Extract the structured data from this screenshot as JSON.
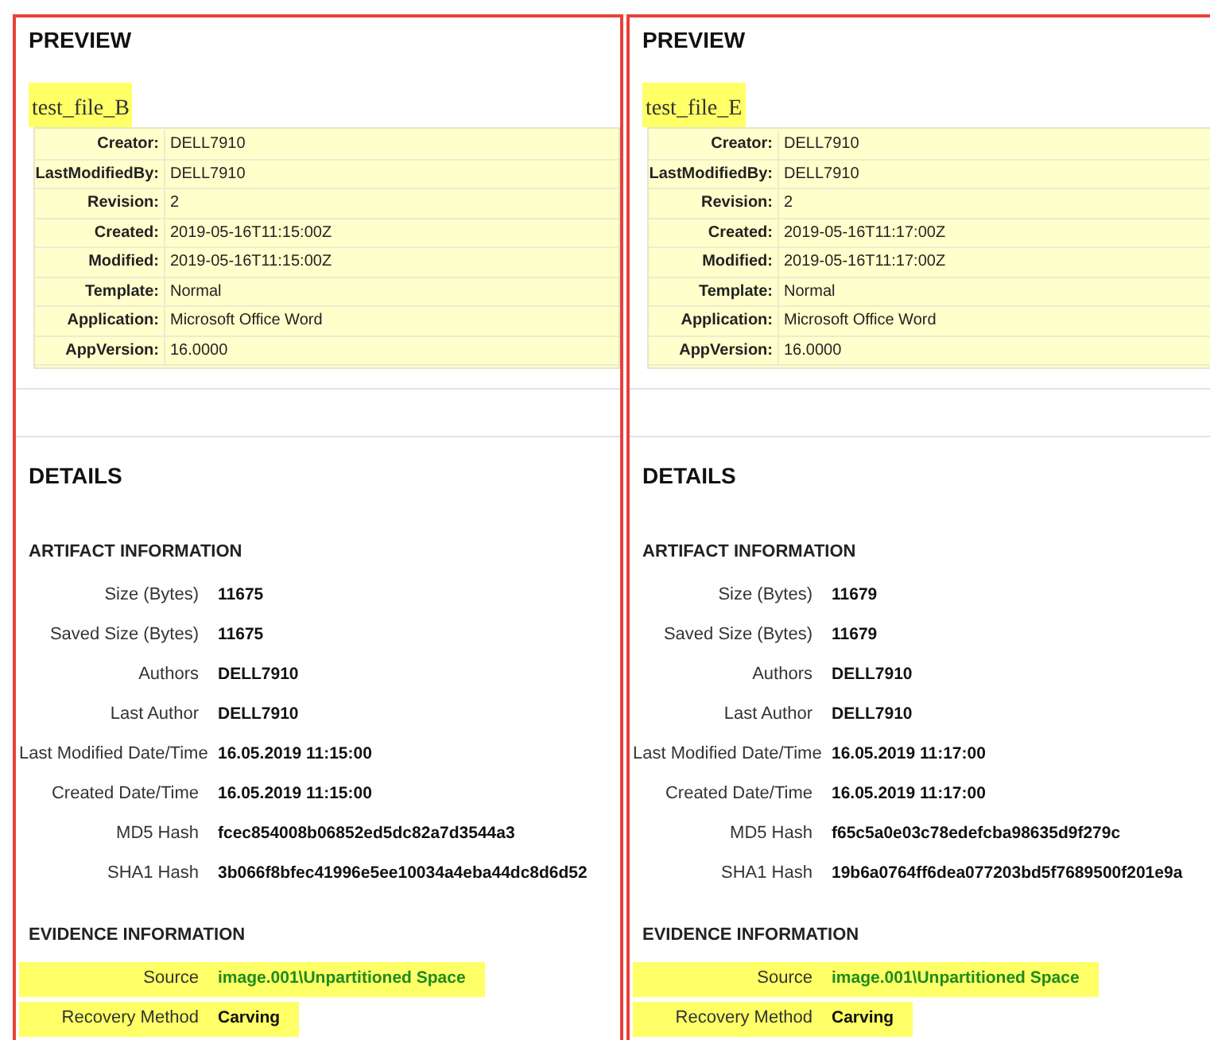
{
  "panels": [
    {
      "preview": {
        "heading": "PREVIEW",
        "file_name": "test_file_B",
        "file_name_highlighted": true,
        "properties": [
          {
            "label": "Creator:",
            "value": "DELL7910"
          },
          {
            "label": "LastModifiedBy:",
            "value": "DELL7910"
          },
          {
            "label": "Revision:",
            "value": "2"
          },
          {
            "label": "Created:",
            "value": "2019-05-16T11:15:00Z"
          },
          {
            "label": "Modified:",
            "value": "2019-05-16T11:15:00Z"
          },
          {
            "label": "Template:",
            "value": "Normal"
          },
          {
            "label": "Application:",
            "value": "Microsoft Office Word"
          },
          {
            "label": "AppVersion:",
            "value": "16.0000"
          }
        ]
      },
      "details": {
        "heading": "DETAILS",
        "sections": [
          {
            "title": "ARTIFACT INFORMATION",
            "fields": [
              {
                "label": "Size (Bytes)",
                "value": "11675",
                "kind": "plain",
                "highlighted": false
              },
              {
                "label": "Saved Size (Bytes)",
                "value": "11675",
                "kind": "plain",
                "highlighted": false
              },
              {
                "label": "Authors",
                "value": "DELL7910",
                "kind": "plain",
                "highlighted": false
              },
              {
                "label": "Last Author",
                "value": "DELL7910",
                "kind": "plain",
                "highlighted": false
              },
              {
                "label": "Last Modified Date/Time",
                "value": "16.05.2019 11:15:00",
                "kind": "plain",
                "highlighted": false
              },
              {
                "label": "Created Date/Time",
                "value": "16.05.2019 11:15:00",
                "kind": "plain",
                "highlighted": false
              },
              {
                "label": "MD5 Hash",
                "value": "fcec854008b06852ed5dc82a7d3544a3",
                "kind": "plain",
                "highlighted": false
              },
              {
                "label": "SHA1 Hash",
                "value": "3b066f8bfec41996e5ee10034a4eba44dc8d6d52",
                "kind": "plain",
                "highlighted": false
              }
            ]
          },
          {
            "title": "EVIDENCE INFORMATION",
            "fields": [
              {
                "label": "Source",
                "value": "image.001\\Unpartitioned Space",
                "kind": "link",
                "highlighted": true
              },
              {
                "label": "Recovery Method",
                "value": "Carving",
                "kind": "plain",
                "highlighted": true
              }
            ]
          }
        ]
      }
    },
    {
      "preview": {
        "heading": "PREVIEW",
        "file_name": "test_file_E",
        "file_name_highlighted": true,
        "properties": [
          {
            "label": "Creator:",
            "value": "DELL7910"
          },
          {
            "label": "LastModifiedBy:",
            "value": "DELL7910"
          },
          {
            "label": "Revision:",
            "value": "2"
          },
          {
            "label": "Created:",
            "value": "2019-05-16T11:17:00Z"
          },
          {
            "label": "Modified:",
            "value": "2019-05-16T11:17:00Z"
          },
          {
            "label": "Template:",
            "value": "Normal"
          },
          {
            "label": "Application:",
            "value": "Microsoft Office Word"
          },
          {
            "label": "AppVersion:",
            "value": "16.0000"
          }
        ]
      },
      "details": {
        "heading": "DETAILS",
        "sections": [
          {
            "title": "ARTIFACT INFORMATION",
            "fields": [
              {
                "label": "Size (Bytes)",
                "value": "11679",
                "kind": "plain",
                "highlighted": false
              },
              {
                "label": "Saved Size (Bytes)",
                "value": "11679",
                "kind": "plain",
                "highlighted": false
              },
              {
                "label": "Authors",
                "value": "DELL7910",
                "kind": "plain",
                "highlighted": false
              },
              {
                "label": "Last Author",
                "value": "DELL7910",
                "kind": "plain",
                "highlighted": false
              },
              {
                "label": "Last Modified Date/Time",
                "value": "16.05.2019 11:17:00",
                "kind": "plain",
                "highlighted": false
              },
              {
                "label": "Created Date/Time",
                "value": "16.05.2019 11:17:00",
                "kind": "plain",
                "highlighted": false
              },
              {
                "label": "MD5 Hash",
                "value": "f65c5a0e03c78edefcba98635d9f279c",
                "kind": "plain",
                "highlighted": false
              },
              {
                "label": "SHA1 Hash",
                "value": "19b6a0764ff6dea077203bd5f7689500f201e9a",
                "kind": "plain",
                "highlighted": false
              }
            ]
          },
          {
            "title": "EVIDENCE INFORMATION",
            "fields": [
              {
                "label": "Source",
                "value": "image.001\\Unpartitioned Space",
                "kind": "link",
                "highlighted": true
              },
              {
                "label": "Recovery Method",
                "value": "Carving",
                "kind": "plain",
                "highlighted": true
              }
            ]
          }
        ]
      }
    }
  ]
}
